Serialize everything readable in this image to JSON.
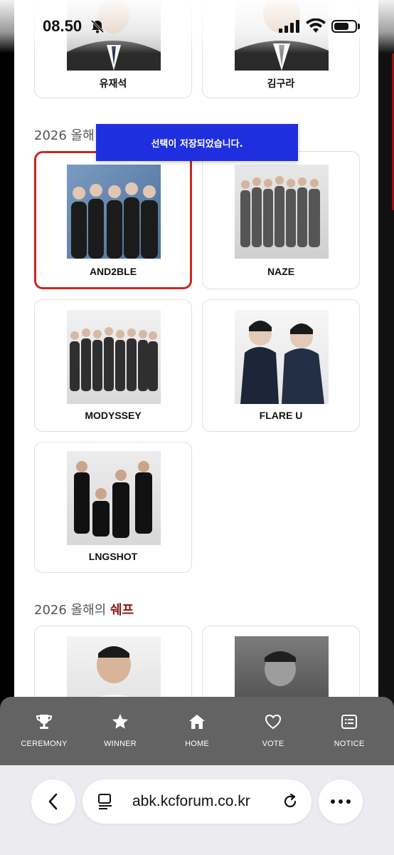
{
  "status": {
    "time": "08.50"
  },
  "toast": {
    "message": "선택이 저장되었습니다."
  },
  "section_groups": {
    "prefix": "2026 올해",
    "prefix_chef": "2026 올해의",
    "chef_accent": "쉐프"
  },
  "top_cards": [
    {
      "name": "유재석"
    },
    {
      "name": "김구라"
    }
  ],
  "group_cards": [
    {
      "name": "AND2BLE",
      "selected": true
    },
    {
      "name": "NAZE",
      "selected": false
    },
    {
      "name": "MODYSSEY",
      "selected": false
    },
    {
      "name": "FLARE U",
      "selected": false
    },
    {
      "name": "LNGSHOT",
      "selected": false
    }
  ],
  "nav": {
    "ceremony": "CEREMONY",
    "winner": "WINNER",
    "home": "HOME",
    "vote": "VOTE",
    "notice": "NOTICE"
  },
  "browser": {
    "url": "abk.kcforum.co.kr"
  },
  "colors": {
    "toast": "#1f2fe0",
    "selected_border": "#c8281e",
    "accent": "#8b1a1a",
    "nav_bg": "#636363"
  }
}
